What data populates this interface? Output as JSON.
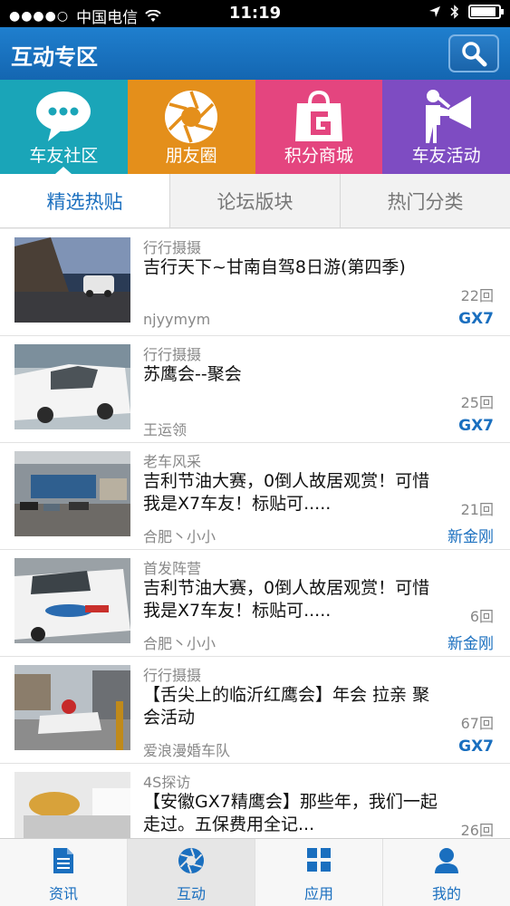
{
  "status_bar": {
    "carrier": "中国电信",
    "time": "11:19"
  },
  "header": {
    "title": "互动专区",
    "search_icon": "search-icon"
  },
  "tiles": [
    {
      "label": "车友社区",
      "icon": "chat-bubble-icon",
      "color": "#1aa5b8",
      "active": true
    },
    {
      "label": "朋友圈",
      "icon": "aperture-icon",
      "color": "#e48f1b",
      "active": false
    },
    {
      "label": "积分商城",
      "icon": "shopping-bag-icon",
      "color": "#e4457f",
      "active": false
    },
    {
      "label": "车友活动",
      "icon": "megaphone-person-icon",
      "color": "#7e4cc2",
      "active": false
    }
  ],
  "tabs": [
    {
      "label": "精选热贴",
      "active": true
    },
    {
      "label": "论坛版块",
      "active": false
    },
    {
      "label": "热门分类",
      "active": false
    }
  ],
  "posts": [
    {
      "category": "行行摄摄",
      "title": "吉行天下~甘南自驾8日游(第四季)",
      "replies": "22回",
      "author": "njyymym",
      "tag": "GX7"
    },
    {
      "category": "行行摄摄",
      "title": "苏鹰会--聚会",
      "replies": "25回",
      "author": "王运领",
      "tag": "GX7"
    },
    {
      "category": "老车风采",
      "title": "吉利节油大赛，0倒人故居观赏！可惜我是X7车友！标贴可.....",
      "replies": "21回",
      "author": "合肥丶小小",
      "tag": "新金刚"
    },
    {
      "category": "首发阵营",
      "title": "吉利节油大赛，0倒人故居观赏！可惜我是X7车友！标贴可.....",
      "replies": "6回",
      "author": "合肥丶小小",
      "tag": "新金刚"
    },
    {
      "category": "行行摄摄",
      "title": "【舌尖上的临沂红鹰会】年会 拉亲 聚会活动",
      "replies": "67回",
      "author": "爱浪漫婚车队",
      "tag": "GX7"
    },
    {
      "category": "4S探访",
      "title": "【安徽GX7精鹰会】那些年，我们一起走过。五保费用全记...",
      "replies": "26回",
      "author": "",
      "tag": ""
    }
  ],
  "bottom_nav": [
    {
      "label": "资讯",
      "icon": "document-icon",
      "active": false
    },
    {
      "label": "互动",
      "icon": "aperture-icon",
      "active": true
    },
    {
      "label": "应用",
      "icon": "grid-apps-icon",
      "active": false
    },
    {
      "label": "我的",
      "icon": "person-icon",
      "active": false
    }
  ],
  "colors": {
    "header_blue": "#1a6fbf",
    "link_blue": "#1a6fbf"
  }
}
